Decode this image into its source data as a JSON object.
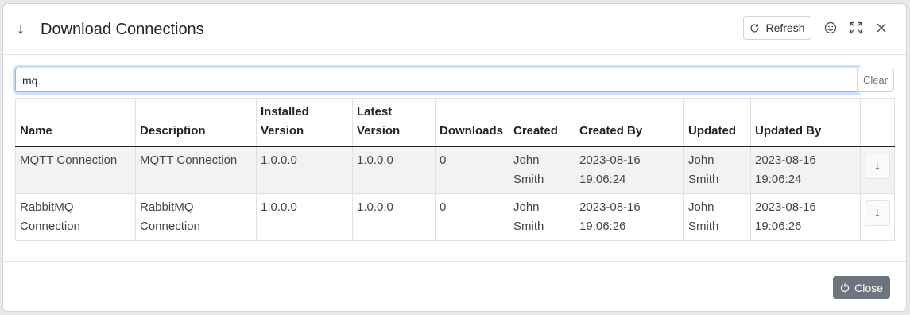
{
  "dialog": {
    "title": "Download Connections",
    "title_icon": "arrow-down-icon",
    "refresh_label": "Refresh",
    "header_icons": [
      "smiley-icon",
      "maximize-icon",
      "close-icon"
    ]
  },
  "search": {
    "value": "mq",
    "clear_label": "Clear"
  },
  "table": {
    "columns": [
      "Name",
      "Description",
      "Installed Version",
      "Latest Version",
      "Downloads",
      "Created",
      "Created By",
      "Updated",
      "Updated By",
      ""
    ],
    "rows": [
      {
        "name": "MQTT Connection",
        "description": "MQTT Connection",
        "installed_version": "1.0.0.0",
        "latest_version": "1.0.0.0",
        "downloads": "0",
        "created": "John Smith",
        "created_by": "2023-08-16 19:06:24",
        "updated": "John Smith",
        "updated_by": "2023-08-16 19:06:24",
        "action_icon": "arrow-down-icon"
      },
      {
        "name": "RabbitMQ Connection",
        "description": "RabbitMQ Connection",
        "installed_version": "1.0.0.0",
        "latest_version": "1.0.0.0",
        "downloads": "0",
        "created": "John Smith",
        "created_by": "2023-08-16 19:06:26",
        "updated": "John Smith",
        "updated_by": "2023-08-16 19:06:26",
        "action_icon": "arrow-down-icon"
      }
    ]
  },
  "footer": {
    "close_label": "Close"
  },
  "colors": {
    "close_button": "#6c757d",
    "focus_border": "#86b7fe",
    "row_stripe": "#f2f2f2"
  }
}
